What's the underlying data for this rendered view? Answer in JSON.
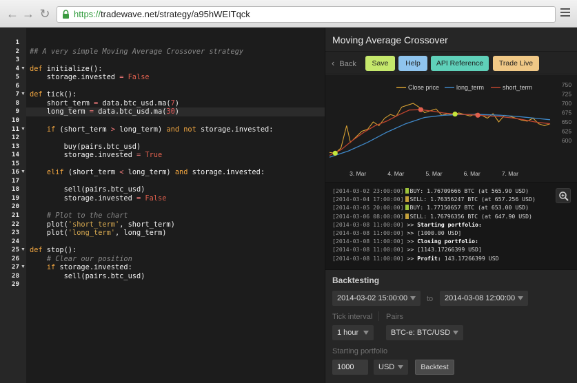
{
  "browser": {
    "url_scheme": "https://",
    "url_rest": "tradewave.net/strategy/a95hWEITqck"
  },
  "editor": {
    "lines": [
      {
        "n": "1",
        "html": ""
      },
      {
        "n": "2",
        "html": "<span class=\"tk-cm\">## A very simple Moving Average Crossover strategy</span>"
      },
      {
        "n": "3",
        "html": ""
      },
      {
        "n": "4",
        "html": "<span class=\"tk-kw\">def</span> initialize():",
        "fold": true
      },
      {
        "n": "5",
        "html": "    storage.invested <span class=\"tk-op\">=</span> <span class=\"tk-const\">False</span>"
      },
      {
        "n": "6",
        "html": ""
      },
      {
        "n": "7",
        "html": "<span class=\"tk-kw\">def</span> tick():",
        "fold": true
      },
      {
        "n": "8",
        "html": "    short_term <span class=\"tk-op\">=</span> data.btc_usd.ma(<span class=\"tk-num\">7</span>)"
      },
      {
        "n": "9",
        "html": "    long_term <span class=\"tk-op\">=</span> data.btc_usd.ma(<span class=\"tk-num\">30</span>)",
        "active": true
      },
      {
        "n": "10",
        "html": ""
      },
      {
        "n": "11",
        "html": "    <span class=\"tk-kw\">if</span> (short_term <span class=\"tk-op\">&gt;</span> long_term) <span class=\"tk-kw\">and not</span> storage.invested:",
        "fold": true
      },
      {
        "n": "12",
        "html": ""
      },
      {
        "n": "13",
        "html": "        buy(pairs.btc_usd)"
      },
      {
        "n": "14",
        "html": "        storage.invested <span class=\"tk-op\">=</span> <span class=\"tk-const\">True</span>"
      },
      {
        "n": "15",
        "html": ""
      },
      {
        "n": "16",
        "html": "    <span class=\"tk-kw\">elif</span> (short_term <span class=\"tk-op\">&lt;</span> long_term) <span class=\"tk-kw\">and</span> storage.invested:",
        "fold": true
      },
      {
        "n": "17",
        "html": ""
      },
      {
        "n": "18",
        "html": "        sell(pairs.btc_usd)"
      },
      {
        "n": "19",
        "html": "        storage.invested <span class=\"tk-op\">=</span> <span class=\"tk-const\">False</span>"
      },
      {
        "n": "20",
        "html": ""
      },
      {
        "n": "21",
        "html": "    <span class=\"tk-cm\"># Plot to the chart</span>"
      },
      {
        "n": "22",
        "html": "    plot(<span class=\"tk-str\">'short_term'</span>, short_term)"
      },
      {
        "n": "23",
        "html": "    plot(<span class=\"tk-str\">'long_term'</span>, long_term)"
      },
      {
        "n": "24",
        "html": ""
      },
      {
        "n": "25",
        "html": "<span class=\"tk-kw\">def</span> stop():",
        "fold": true
      },
      {
        "n": "26",
        "html": "    <span class=\"tk-cm\"># Clear our position</span>"
      },
      {
        "n": "27",
        "html": "    <span class=\"tk-kw\">if</span> storage.invested:",
        "fold": true
      },
      {
        "n": "28",
        "html": "        sell(pairs.btc_usd)"
      },
      {
        "n": "29",
        "html": ""
      }
    ]
  },
  "panel": {
    "title": "Moving Average Crossover",
    "back_label": "Back",
    "buttons": [
      {
        "label": "Save",
        "color": "#c5e86c"
      },
      {
        "label": "Help",
        "color": "#8fc4ee"
      },
      {
        "label": "API Reference",
        "color": "#5fd0b9"
      },
      {
        "label": "Trade Live",
        "color": "#f0c886"
      }
    ]
  },
  "chart_data": {
    "type": "line",
    "title": "",
    "xlabel": "",
    "ylabel": "",
    "x_ticks": [
      "3. Mar",
      "4. Mar",
      "5. Mar",
      "6. Mar",
      "7. Mar"
    ],
    "y_ticks": [
      600,
      625,
      650,
      675,
      700,
      725,
      750
    ],
    "ylim": [
      550,
      750
    ],
    "legend_position": "top",
    "series": [
      {
        "name": "Close price",
        "color": "#d9a233",
        "x": [
          2.0,
          2.15,
          2.3,
          2.45,
          2.55,
          2.7,
          2.85,
          3.0,
          3.15,
          3.3,
          3.45,
          3.6,
          3.75,
          3.9,
          4.05,
          4.2,
          4.35,
          4.5,
          4.65,
          4.8,
          4.95,
          5.1,
          5.25,
          5.4,
          5.55,
          5.7,
          5.85,
          6.0,
          6.15,
          6.3,
          6.45,
          6.6,
          6.75,
          6.9,
          7.05,
          7.2,
          7.35,
          7.5,
          7.65,
          7.8
        ],
        "values": [
          568,
          566,
          580,
          640,
          595,
          610,
          625,
          630,
          650,
          640,
          660,
          670,
          665,
          690,
          695,
          700,
          690,
          675,
          680,
          685,
          668,
          672,
          669,
          674,
          670,
          666,
          672,
          668,
          660,
          672,
          650,
          668,
          665,
          660,
          655,
          652,
          660,
          645,
          640,
          645
        ]
      },
      {
        "name": "long_term",
        "color": "#3f88c8",
        "x": [
          2.0,
          2.5,
          3.0,
          3.5,
          4.0,
          4.5,
          5.0,
          5.5,
          6.0,
          6.5,
          7.0,
          7.5,
          7.8
        ],
        "values": [
          555,
          572,
          595,
          622,
          645,
          662,
          668,
          670,
          670,
          668,
          664,
          659,
          656
        ]
      },
      {
        "name": "short_term",
        "color": "#c0442e",
        "x": [
          2.0,
          2.3,
          2.6,
          2.9,
          3.2,
          3.5,
          3.8,
          4.1,
          4.4,
          4.7,
          5.0,
          5.3,
          5.6,
          5.9,
          6.2,
          6.5,
          6.8,
          7.1,
          7.4,
          7.8
        ],
        "values": [
          560,
          575,
          600,
          622,
          640,
          652,
          668,
          682,
          683,
          679,
          674,
          671,
          670,
          668,
          666,
          664,
          661,
          656,
          650,
          645
        ]
      }
    ],
    "markers": [
      {
        "type": "buy",
        "x": 2.15,
        "y": 566,
        "color": "#c5e63c"
      },
      {
        "type": "sell",
        "x": 4.4,
        "y": 683,
        "color": "#e0604e"
      },
      {
        "type": "buy",
        "x": 5.3,
        "y": 671,
        "color": "#c5e63c"
      },
      {
        "type": "sell",
        "x": 5.9,
        "y": 668,
        "color": "#e0604e"
      }
    ]
  },
  "log": {
    "lines": [
      {
        "ts": "[2014-03-02 23:00:00]",
        "marker": "#9ec33b",
        "msg": "BUY: 1.76709666 BTC (at 565.90 USD)"
      },
      {
        "ts": "[2014-03-04 17:00:00]",
        "marker": "#c4a03a",
        "msg": "SELL: 1.76356247 BTC (at 657.256 USD)"
      },
      {
        "ts": "[2014-03-05 20:00:00]",
        "marker": "#9ec33b",
        "msg": "BUY: 1.77150657 BTC (at 653.00 USD)"
      },
      {
        "ts": "[2014-03-06 08:00:00]",
        "marker": "#c4a03a",
        "msg": "SELL: 1.76796356 BTC (at 647.90 USD)"
      },
      {
        "ts": "[2014-03-08 11:00:00]",
        "prefix": ">>",
        "em": "Starting portfolio:",
        "msg": ""
      },
      {
        "ts": "[2014-03-08 11:00:00]",
        "prefix": ">>",
        "msg": "[1000.00 USD]"
      },
      {
        "ts": "[2014-03-08 11:00:00]",
        "prefix": ">>",
        "em": "Closing portfolio:",
        "msg": ""
      },
      {
        "ts": "[2014-03-08 11:00:00]",
        "prefix": ">>",
        "msg": "[1143.17266399 USD]"
      },
      {
        "ts": "[2014-03-08 11:00:00]",
        "prefix": ">>",
        "em": "Profit:",
        "msg": " 143.17266399 USD"
      }
    ]
  },
  "backtest": {
    "title": "Backtesting",
    "start": "2014-03-02 15:00:00",
    "to_label": "to",
    "end": "2014-03-08 12:00:00",
    "tick_label": "Tick interval",
    "tick_value": "1 hour",
    "pairs_label": "Pairs",
    "pairs_value": "BTC-e: BTC/USD",
    "portfolio_label": "Starting portfolio",
    "portfolio_value": "1000",
    "currency": "USD",
    "run_label": "Backtest"
  }
}
